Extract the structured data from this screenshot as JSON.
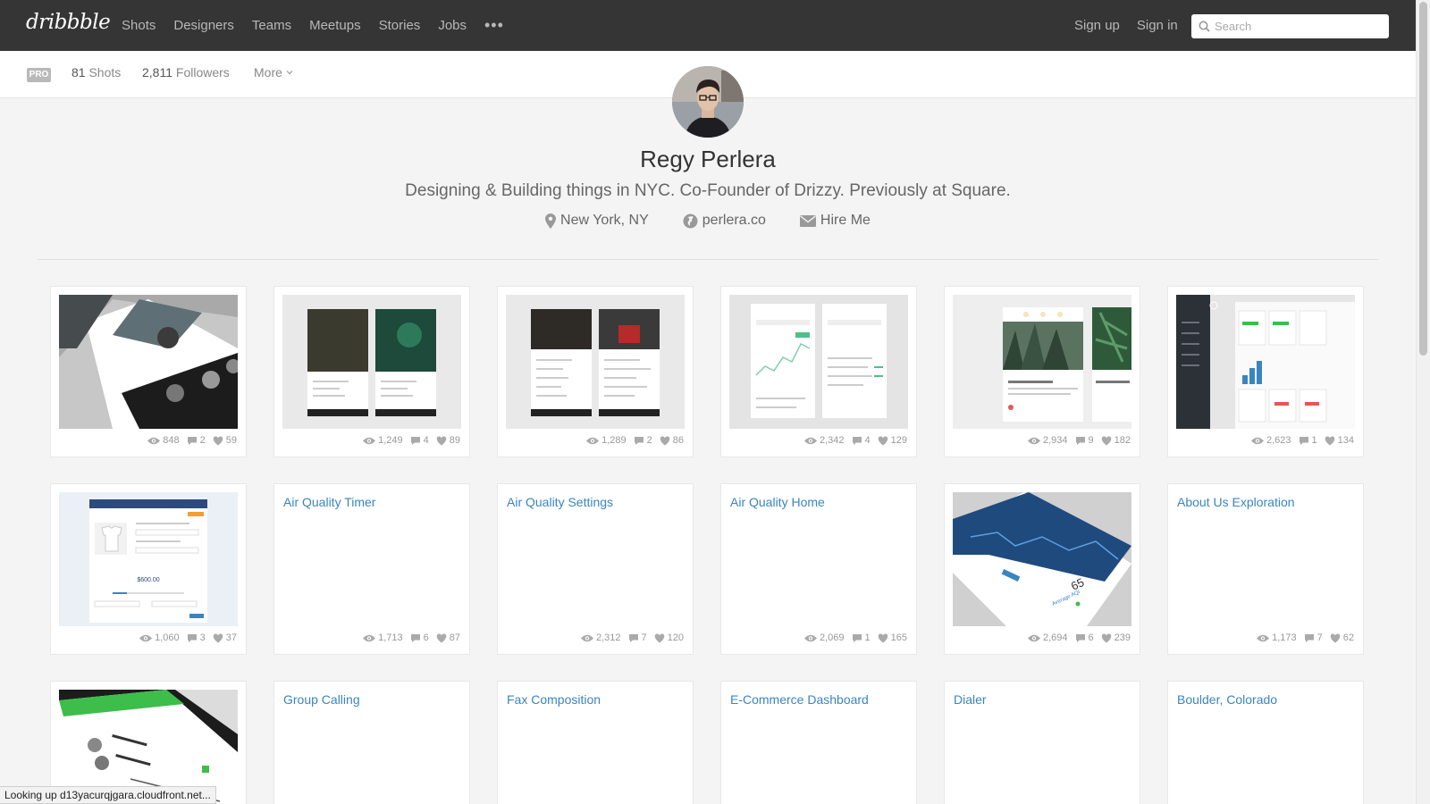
{
  "nav": {
    "logo": "dribbble",
    "items": [
      "Shots",
      "Designers",
      "Teams",
      "Meetups",
      "Stories",
      "Jobs"
    ],
    "more_icon": "ellipsis-icon",
    "sign_up": "Sign up",
    "sign_in": "Sign in",
    "search_placeholder": "Search"
  },
  "subnav": {
    "badge": "PRO",
    "shots_count": "81",
    "shots_label": "Shots",
    "followers_count": "2,811",
    "followers_label": "Followers",
    "more_label": "More"
  },
  "profile": {
    "name": "Regy Perlera",
    "bio": "Designing & Building things in NYC. Co-Founder of Drizzy. Previously at Square.",
    "location": "New York, NY",
    "website": "perlera.co",
    "hire": "Hire Me"
  },
  "shots": [
    {
      "title": "",
      "views": "848",
      "comments": "2",
      "likes": "59",
      "thumb": "profile-app-tilted"
    },
    {
      "title": "",
      "views": "1,249",
      "comments": "4",
      "likes": "89",
      "thumb": "music-artist-screens"
    },
    {
      "title": "",
      "views": "1,289",
      "comments": "2",
      "likes": "86",
      "thumb": "artist-list-screens"
    },
    {
      "title": "",
      "views": "2,342",
      "comments": "4",
      "likes": "129",
      "thumb": "sales-trends-screens"
    },
    {
      "title": "",
      "views": "2,934",
      "comments": "9",
      "likes": "182",
      "thumb": "travel-cards"
    },
    {
      "title": "",
      "views": "2,623",
      "comments": "1",
      "likes": "134",
      "thumb": "dark-sidebar-dashboard"
    },
    {
      "title": "",
      "views": "1,060",
      "comments": "3",
      "likes": "37",
      "thumb": "tshirt-checkout"
    },
    {
      "title": "Air Quality Timer",
      "views": "1,713",
      "comments": "6",
      "likes": "87",
      "thumb": ""
    },
    {
      "title": "Air Quality Settings",
      "views": "2,312",
      "comments": "7",
      "likes": "120",
      "thumb": ""
    },
    {
      "title": "Air Quality Home",
      "views": "2,069",
      "comments": "1",
      "likes": "165",
      "thumb": ""
    },
    {
      "title": "",
      "views": "2,694",
      "comments": "6",
      "likes": "239",
      "thumb": "air-quality-tilted"
    },
    {
      "title": "About Us Exploration",
      "views": "1,173",
      "comments": "7",
      "likes": "62",
      "thumb": ""
    },
    {
      "title": "",
      "views": "",
      "comments": "",
      "likes": "",
      "thumb": "voicemail-phone"
    },
    {
      "title": "Group Calling",
      "views": "",
      "comments": "",
      "likes": "",
      "thumb": ""
    },
    {
      "title": "Fax Composition",
      "views": "",
      "comments": "",
      "likes": "",
      "thumb": ""
    },
    {
      "title": "E-Commerce Dashboard",
      "views": "",
      "comments": "",
      "likes": "",
      "thumb": ""
    },
    {
      "title": "Dialer",
      "views": "",
      "comments": "",
      "likes": "",
      "thumb": ""
    },
    {
      "title": "Boulder, Colorado",
      "views": "",
      "comments": "",
      "likes": "",
      "thumb": ""
    }
  ],
  "status": "Looking up d13yacurqjgara.cloudfront.net...",
  "colors": {
    "topbar": "#353535",
    "link": "#3a85c0",
    "background": "#f4f4f4",
    "accent_green": "#3dbd4a"
  }
}
